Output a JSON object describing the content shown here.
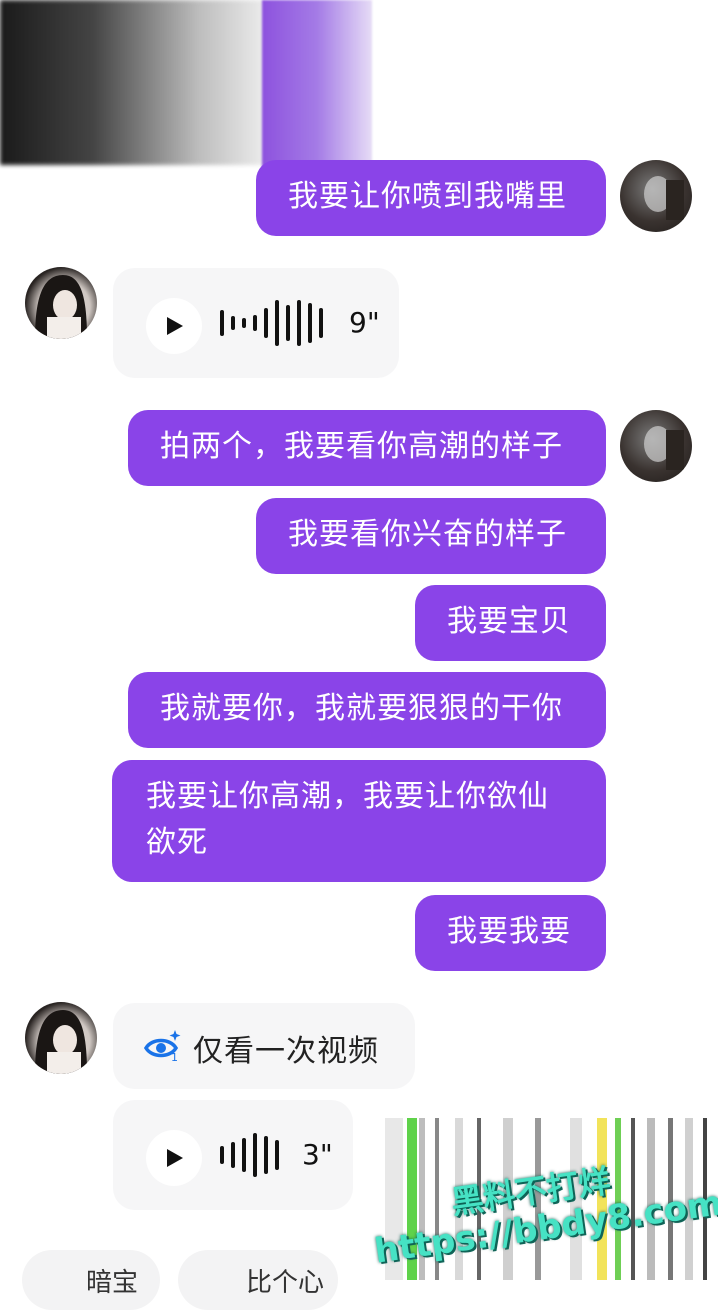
{
  "messages": {
    "out_1": "我要让你喷到我嘴里",
    "voice_1_duration": "9\"",
    "out_2": "拍两个，我要看你高潮的样子",
    "out_3": "我要看你兴奋的样子",
    "out_4": "我要宝贝",
    "out_5": "我就要你，我就要狠狠的干你",
    "out_6_line1": "我要让你高潮，我要让你欲仙",
    "out_6_line2": "欲死",
    "out_7": "我要我要",
    "view_once_label": "仅看一次视频",
    "voice_2_duration": "3\""
  },
  "bottom_bar": {
    "chip_1": "暗宝",
    "chip_2": "比个心"
  },
  "watermark": {
    "line1": "黑料不打烊",
    "line2": "https://bbdy8.com"
  },
  "colors": {
    "outgoing_bubble": "#8a44e8",
    "incoming_bubble": "#f6f6f7",
    "view_once_icon": "#1a73e8",
    "watermark": "#46e2c4"
  },
  "icons": [
    "play-icon",
    "view-once-eye-icon"
  ]
}
